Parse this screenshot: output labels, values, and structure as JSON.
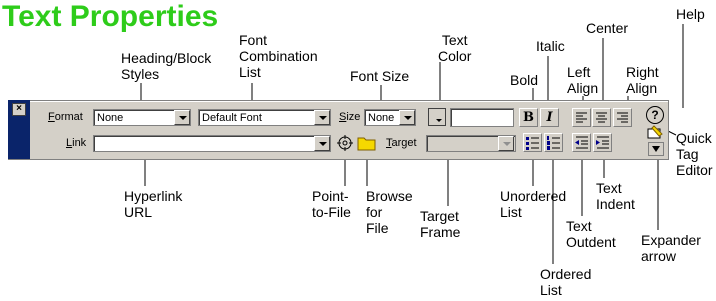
{
  "title": "Text Properties",
  "callouts": {
    "heading_block_styles": "Heading/Block\nStyles",
    "font_combination_list": "Font\nCombination\nList",
    "font_size": "Font Size",
    "text_color": "Text\nColor",
    "bold": "Bold",
    "italic": "Italic",
    "left_align": "Left\nAlign",
    "center": "Center",
    "right_align": "Right\nAlign",
    "help": "Help",
    "quick_tag_editor": "Quick\nTag\nEditor",
    "hyperlink_url": "Hyperlink\nURL",
    "point_to_file": "Point-\nto-File",
    "browse_for_file": "Browse\nfor\nFile",
    "target_frame": "Target\nFrame",
    "unordered_list": "Unordered\nList",
    "ordered_list": "Ordered\nList",
    "text_outdent": "Text\nOutdent",
    "text_indent": "Text\nIndent",
    "expander_arrow": "Expander\narrow"
  },
  "toolbar": {
    "close_glyph": "×",
    "format_label_u": "F",
    "format_label_rest": "ormat",
    "format_value": "None",
    "font_value": "Default Font",
    "size_label_u": "S",
    "size_label_rest": "ize",
    "size_value": "None",
    "link_label_u": "L",
    "link_label_rest": "ink",
    "link_value": "",
    "target_label_u": "T",
    "target_label_rest": "arget",
    "target_value": "",
    "bold_glyph": "B",
    "italic_glyph": "I",
    "help_glyph": "?",
    "icons": [
      "close-icon",
      "point-to-file-icon",
      "browse-folder-icon",
      "unordered-list-icon",
      "ordered-list-icon",
      "outdent-icon",
      "indent-icon",
      "align-left-icon",
      "align-center-icon",
      "align-right-icon",
      "help-icon",
      "quick-tag-editor-icon",
      "expander-arrow-icon"
    ]
  }
}
